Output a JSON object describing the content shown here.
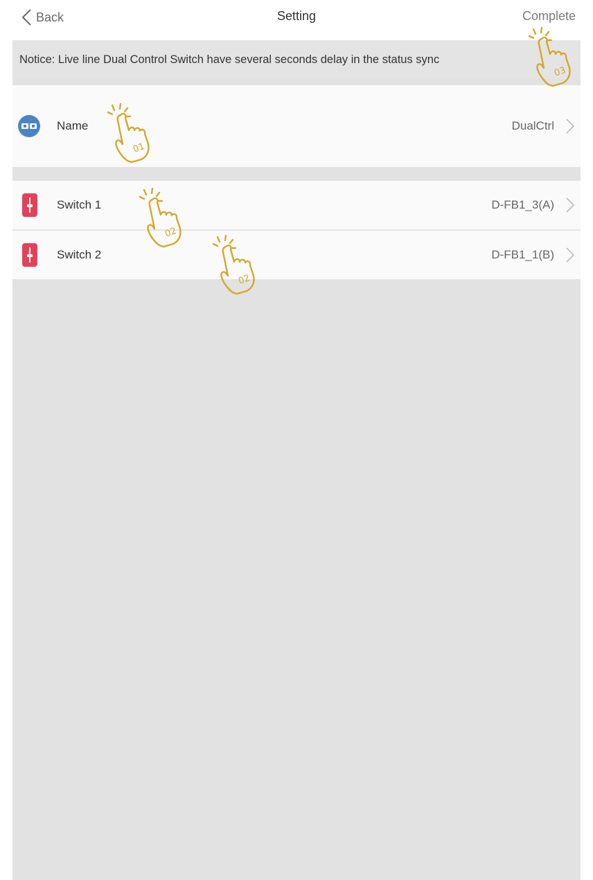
{
  "header": {
    "back_label": "Back",
    "title": "Setting",
    "complete_label": "Complete"
  },
  "notice": "Notice: Live line Dual Control Switch have several seconds delay in the status sync",
  "name_row": {
    "label": "Name",
    "value": "DualCtrl",
    "icon": "device-pair-icon"
  },
  "switches": [
    {
      "label": "Switch 1",
      "value": "D-FB1_3(A)",
      "icon": "wall-switch-icon"
    },
    {
      "label": "Switch 2",
      "value": "D-FB1_1(B)",
      "icon": "wall-switch-icon"
    }
  ],
  "annotations": [
    {
      "step": "01",
      "target": "name-row"
    },
    {
      "step": "02",
      "target": "switch-1-row"
    },
    {
      "step": "02",
      "target": "switch-2-row"
    },
    {
      "step": "03",
      "target": "complete-button"
    }
  ],
  "colors": {
    "accent_icon_blue": "#4b84c6",
    "switch_icon_red": "#e5405a",
    "annotation_gold": "#d4a82a",
    "background_gray": "#e2e2e2"
  }
}
